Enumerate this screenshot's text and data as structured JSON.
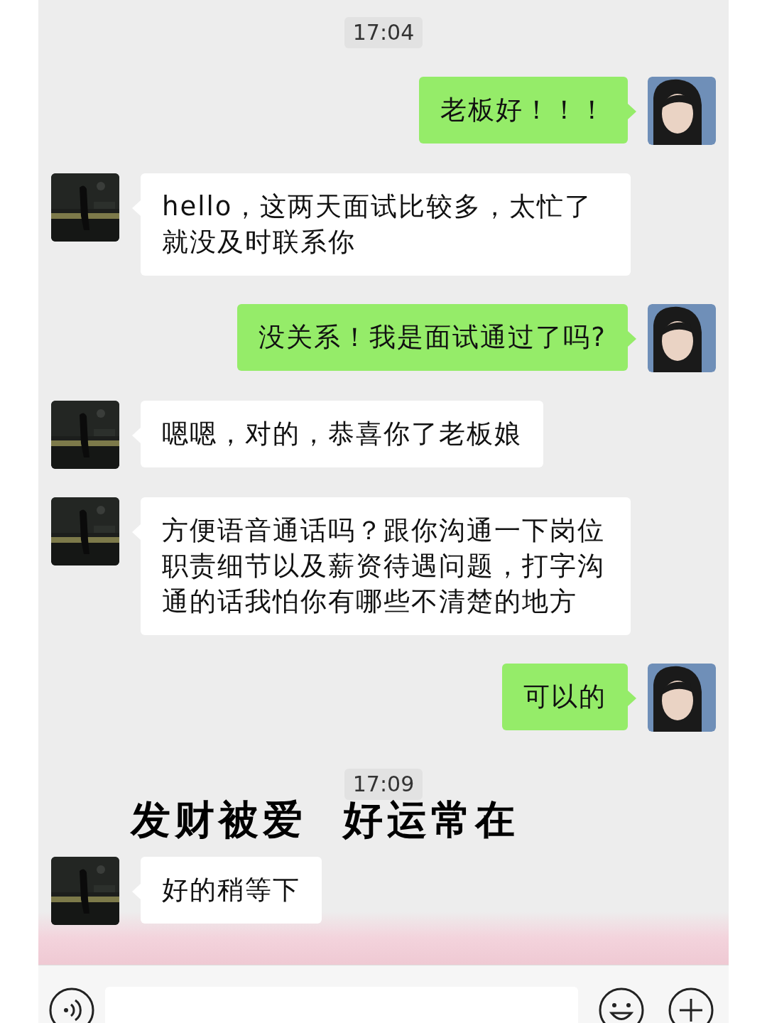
{
  "messages": [
    {
      "kind": "time",
      "text": "17:04"
    },
    {
      "kind": "text",
      "outgoing": true,
      "text": "老板好！！！"
    },
    {
      "kind": "text",
      "outgoing": false,
      "text": "hello，这两天面试比较多，太忙了就没及时联系你"
    },
    {
      "kind": "text",
      "outgoing": true,
      "text": "没关系！我是面试通过了吗?"
    },
    {
      "kind": "text",
      "outgoing": false,
      "text": "嗯嗯，对的，恭喜你了老板娘"
    },
    {
      "kind": "text",
      "outgoing": false,
      "text": "方便语音通话吗？跟你沟通一下岗位职责细节以及薪资待遇问题，打字沟通的话我怕你有哪些不清楚的地方"
    },
    {
      "kind": "text",
      "outgoing": true,
      "text": "可以的"
    },
    {
      "kind": "time",
      "text": "17:09"
    },
    {
      "kind": "text",
      "outgoing": false,
      "text": "好的稍等下"
    }
  ],
  "overlay_text": "发财被爱  好运常在"
}
